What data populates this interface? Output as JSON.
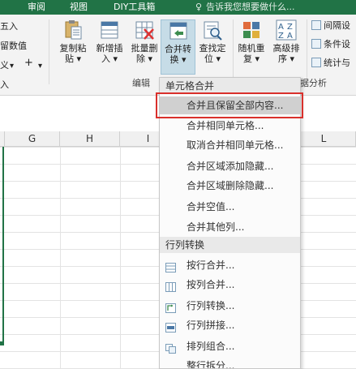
{
  "tabs": [
    "审阅",
    "视图",
    "DIY工具箱"
  ],
  "tell_me": "告诉我您想要做什么...",
  "ribbon": {
    "left_fragments": [
      "五入",
      "留数值",
      "义",
      "+",
      "入"
    ],
    "buttons": [
      {
        "line1": "复制粘",
        "line2": "贴 ▾"
      },
      {
        "line1": "新增插",
        "line2": "入 ▾"
      },
      {
        "line1": "批量删",
        "line2": "除 ▾"
      },
      {
        "line1": "合并转",
        "line2": "换 ▾"
      },
      {
        "line1": "查找定",
        "line2": "位 ▾"
      },
      {
        "line1": "随机重",
        "line2": "复 ▾"
      },
      {
        "line1": "高级排",
        "line2": "序 ▾"
      }
    ],
    "right_items": [
      "间隔设",
      "条件设",
      "统计与"
    ],
    "group_label": "编辑",
    "group_label_right": "据分析"
  },
  "columns": [
    "G",
    "H",
    "I",
    "L"
  ],
  "menu": {
    "section1_title": "单元格合并",
    "section1_items": [
      "合并且保留全部内容...",
      "合并相同单元格...",
      "取消合并相同单元格...",
      "合并区域添加隐藏...",
      "合并区域删除隐藏...",
      "合并空值...",
      "合并其他列..."
    ],
    "section2_title": "行列转换",
    "section2_items": [
      "按行合并...",
      "按列合并...",
      "行列转换...",
      "行列拼接...",
      "排列组合...",
      "整行拆分..."
    ]
  },
  "colors": {
    "accent": "#217346",
    "highlight_border": "#d9302c"
  }
}
